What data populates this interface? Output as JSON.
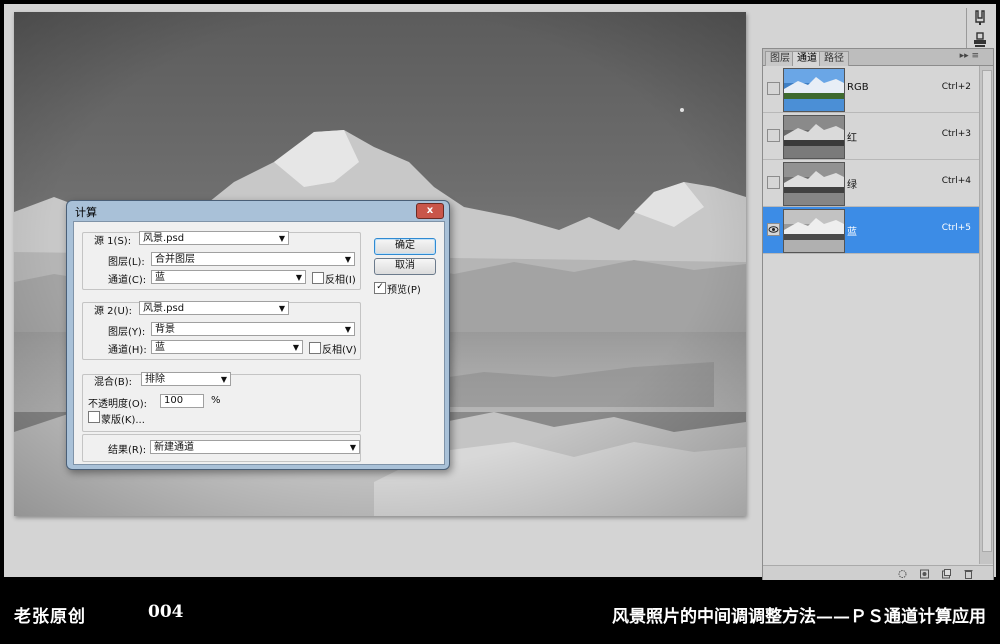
{
  "panel": {
    "tabs": [
      "图层",
      "通道",
      "路径"
    ],
    "active_tab": "通道",
    "menu_glyph": "▸▸ ≡",
    "channels": [
      {
        "name": "RGB",
        "shortcut": "Ctrl+2",
        "visible": false,
        "selected": false,
        "thumb": "color"
      },
      {
        "name": "红",
        "shortcut": "Ctrl+3",
        "visible": false,
        "selected": false,
        "thumb": "gray"
      },
      {
        "name": "绿",
        "shortcut": "Ctrl+4",
        "visible": false,
        "selected": false,
        "thumb": "gray"
      },
      {
        "name": "蓝",
        "shortcut": "Ctrl+5",
        "visible": true,
        "selected": true,
        "thumb": "gray"
      }
    ]
  },
  "dialog": {
    "title": "计算",
    "close": "x",
    "source1": {
      "label": "源 1(S):",
      "value": "风景.psd",
      "layer_label": "图层(L):",
      "layer_value": "合并图层",
      "channel_label": "通道(C):",
      "channel_value": "蓝",
      "invert_label": "反相(I)",
      "invert_checked": false
    },
    "source2": {
      "label": "源 2(U):",
      "value": "风景.psd",
      "layer_label": "图层(Y):",
      "layer_value": "背景",
      "channel_label": "通道(H):",
      "channel_value": "蓝",
      "invert_label": "反相(V)",
      "invert_checked": false
    },
    "blend": {
      "label": "混合(B):",
      "value": "排除",
      "opacity_label": "不透明度(O):",
      "opacity_value": "100",
      "opacity_unit": "%",
      "mask_label": "蒙版(K)...",
      "mask_checked": false
    },
    "result": {
      "label": "结果(R):",
      "value": "新建通道"
    },
    "ok_label": "确定",
    "cancel_label": "取消",
    "preview_label": "预览(P)",
    "preview_checked": true
  },
  "caption": {
    "author": "老张原创",
    "number": "004",
    "title": "风景照片的中间调调整方法——ＰＳ通道计算应用"
  },
  "colors": {
    "selection": "#3c8ce6",
    "dialog_frame": "#a9c1d8",
    "workspace": "#d4d4d4"
  }
}
